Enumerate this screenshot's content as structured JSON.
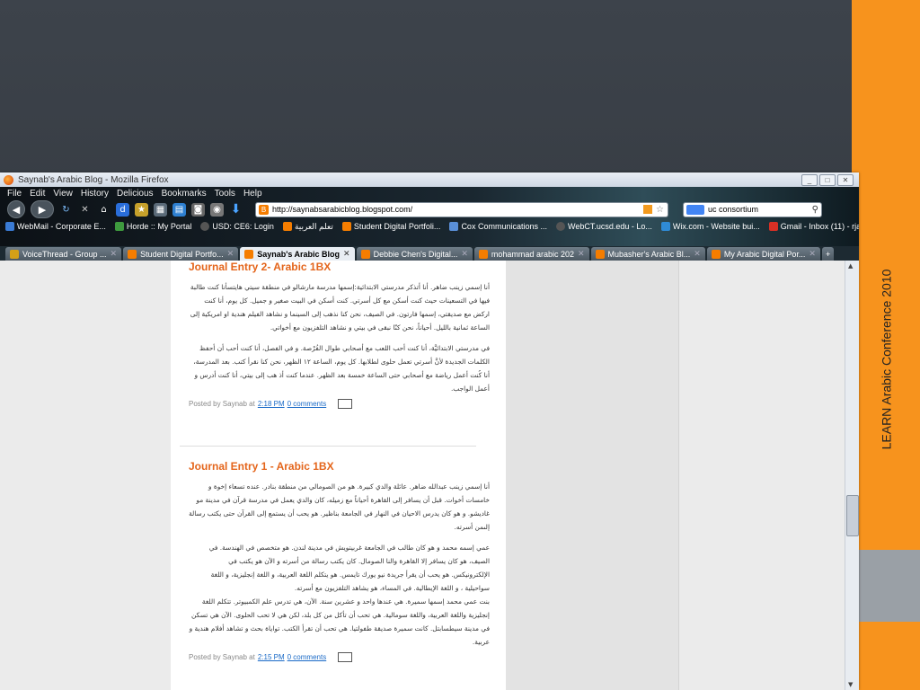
{
  "slide": {
    "side_text": "LEARN Arabic Conference 2010"
  },
  "window": {
    "title": "Saynab's Arabic Blog - Mozilla Firefox"
  },
  "menu": [
    "File",
    "Edit",
    "View",
    "History",
    "Delicious",
    "Bookmarks",
    "Tools",
    "Help"
  ],
  "address": {
    "url": "http://saynabsarabicblog.blogspot.com/"
  },
  "search": {
    "value": "uc consortium"
  },
  "bookmarks": [
    "WebMail - Corporate E...",
    "Horde :: My Portal",
    "USD: CE6: Login",
    "تعلم العربية",
    "Student Digital Portfoli...",
    "Cox Communications ...",
    "WebCT.ucsd.edu - Lo...",
    "Wix.com - Website bui...",
    "Gmail - Inbox (11) - rja..."
  ],
  "tabs": [
    {
      "label": "VoiceThread - Group ..."
    },
    {
      "label": "Student Digital Portfo..."
    },
    {
      "label": "Saynab's Arabic Blog"
    },
    {
      "label": "Debbie Chen's Digital..."
    },
    {
      "label": "mohammad arabic 202"
    },
    {
      "label": "Mubasher's Arabic Bl..."
    },
    {
      "label": "My Arabic Digital Por..."
    }
  ],
  "posts": [
    {
      "title": "Journal Entry 2- Arabic 1BX",
      "paragraphs": [
        "أنا إسمي زينب ضاهر. أنا أتذكر مدرستي الابتدائية:إسمها مدرسة مارشالو في منطقة سيتي هايتسأنا كنت طالبة فيها في التسعينات حيث كنت أسكن مع كل أسرتي. كنت أسكن في البيت صغير و جميل. كل يوم، أنا كنت اركض مع صديقتي، إسمها فارتون. في الصيف، نحن كنا نذهب إلى السينما و نشاهد الفيلم هندية او امريكية إلى الساعة ثمانية بالليل. أحياناً، نحن كنّا نبقى في بيتي و نشاهد التلفزيون مع أخواتي.",
        "في مدرستي الابتدائيَّة، أنا كنت أحب اللعب مع أصحابي طوال الفُرْصة. و في الفصل، أنا كنت أحب أن أحفظ الكلمات الجديدة لأنَّ أسرتي تعمل حلوى لطلابها. كل يوم، الساعة ١٢ الظهر، نحن كنا نقرأ كتب. بعد المدرسة، أنا كُنت أعمل رياضة مع أصحابي حتى الساعة خمسة بعد الظهر. عندما كنت أذ هب إلى بيتي، أنا كنت أدرس و أعمل الواجب."
      ],
      "posted_by": "Posted by Saynab at",
      "time": "2:18 PM",
      "comments": "0 comments"
    },
    {
      "title": "Journal Entry 1 - Arabic 1BX",
      "paragraphs": [
        "أنا إسمي زينب عبدالله ضاهر. عائلة والدي كبيرة. هو من الصومالي من منطقة بنادر. عنده تسعاء إخوة و خامسات أخوات. قبل أن يسافر إلى القاهرة أحياناً مع زميله، كان والدي يعمل في مدرسة قرآن في مدينة مو غاديشو. و هو كان يدرس الاحيان في النهار في الجامعة بناظير. هو يحب أن يستمع إلى القرآن حتى يكتب رسالة إلىمن أسرته.",
        "عمي إسمه محمد و هو كان طالب في الجامعة غربيتويش في مدينة لندن. هو متخصص في الهندسة. في الصيف، هو كان يسافر إلا القاهرة والنا الصومال. كان يكتب رسالة من أسرته و الآن هو يكتب في الإلكترونيكس. هو يحب أن يقرأ جريدة نيو يورك تايمس. هو يتكلم اللغة العربية، و اللغة إنجليزية، و اللغة سواحيلية ، و اللغة الإيطالية. في المساء، هو يشاهد التلفزيون مع أسرته.",
        "بنت عمي محمد إسمها سميرة. هي عندها واحد و عشرين سنة. الآن، هي تدرس علم الكمبيوتر. تتكلم اللغة إنجليزية واللغة العربية، واللغة سومالية. هي تحب أن تأكل من كل بلد، لكن هي لا تحب الحلوى. الآن هي تسكن في مدينة سيطسابتل. كانت سميرة صديقة طفولتيا. هي تحب أن تقرأ الكتب. تواياة بحث و تشاهد أفلام هندية و عربية."
      ],
      "posted_by": "Posted by Saynab at",
      "time": "2:15 PM",
      "comments": "0 comments"
    }
  ],
  "colors": {
    "accent_orange": "#f7931d",
    "post_title": "#e4651b",
    "link": "#1a6ac7"
  }
}
